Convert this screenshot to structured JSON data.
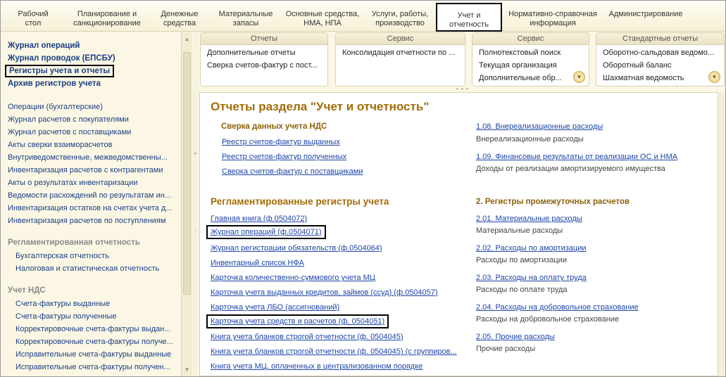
{
  "top_menu": [
    {
      "label": "Рабочий\nстол"
    },
    {
      "label": "Планирование и\nсанкционирование"
    },
    {
      "label": "Денежные\nсредства"
    },
    {
      "label": "Материальные\nзапасы"
    },
    {
      "label": "Основные средства,\nНМА, НПА"
    },
    {
      "label": "Услуги, работы,\nпроизводство"
    },
    {
      "label": "Учет и\nотчетность",
      "active": true
    },
    {
      "label": "Нормативно-справочная\nинформация"
    },
    {
      "label": "Администрирование"
    }
  ],
  "left_nav": {
    "bold_links": [
      "Журнал операций",
      "Журнал проводок (ЕПСБУ)",
      "Регистры учета и отчеты",
      "Архив регистров учета"
    ],
    "links": [
      "Операции (бухгалтерские)",
      "Журнал расчетов с покупателями",
      "Журнал расчетов с поставщиками",
      "Акты сверки взаиморасчетов",
      "Внутриведомственные, межведомственны...",
      "Инвентаризация расчетов с контрагентами",
      "Акты о результатах инвентаризации",
      "Ведомости расхождений по результатам ин...",
      "Инвентаризация остатков на счетах учета д...",
      "Инвентаризация расчетов по поступлениям"
    ],
    "group1": {
      "title": "Регламентированная отчетность",
      "items": [
        "Бухгалтерская отчетность",
        "Налоговая и статистическая отчетность"
      ]
    },
    "group2": {
      "title": "Учет НДС",
      "items": [
        "Счета-фактуры выданные",
        "Счета-фактуры полученные",
        "Корректировочные счета-фактуры выдан...",
        "Корректировочные счета-фактуры получе...",
        "Исправительные счета-фактуры выданные",
        "Исправительные счета-фактуры получен..."
      ]
    }
  },
  "command_panel": [
    {
      "header": "Отчеты",
      "items": [
        "Дополнительные отчеты",
        "Сверка счетов-фактур с пост..."
      ]
    },
    {
      "header": "Сервис",
      "items": [
        "Консолидация отчетности по ..."
      ]
    },
    {
      "header": "Сервис",
      "items": [
        "Полнотекстовый поиск",
        "Текущая организация",
        "Дополнительные обр..."
      ]
    },
    {
      "header": "Стандартные отчеты",
      "items": [
        "Оборотно-сальдовая ведомо...",
        "Оборотный баланс",
        "Шахматная ведомость"
      ]
    }
  ],
  "content": {
    "title": "Отчеты раздела \"Учет и отчетность\"",
    "vat": {
      "title": "Сверка данных учета НДС",
      "links": [
        "Реестр счетов-фактур выданных",
        "Реестр счетов-фактур полученных",
        "Сверка счетов-фактур с поставщиками"
      ]
    },
    "right_top": [
      {
        "link": "1.08. Внереализационные расходы",
        "desc": "Внереализационные расходы"
      },
      {
        "link": "1.09. Финансовые результаты от реализации ОС и НМА",
        "desc": "Доходы от реализации амортизируемого имущества"
      }
    ],
    "registers": {
      "title": "Регламентированные регистры учета",
      "links": [
        "Главная книга (ф.0504072)",
        "Журнал операций (ф.0504071)",
        "Журнал регистрации обязательств (ф.0504064)",
        "Инвентарный список НФА",
        "Карточка количественно-суммового учета МЦ",
        "Карточка учета выданных кредитов, займов (ссуд) (ф.0504057)",
        "Карточка учета ЛБО (ассигнований)",
        "Карточка учета средств и расчетов (ф. 0504051)",
        "Книга учета бланков строгой отчетности (ф. 0504045)",
        "Книга учета бланков строгой отчетности (ф. 0504045) (с группиров...",
        "Книга учета МЦ, оплаченных в централизованном порядке"
      ]
    },
    "intermediate": {
      "title": "2. Регистры промежуточных расчетов",
      "items": [
        {
          "link": "2.01. Материальные расходы",
          "desc": "Материальные расходы"
        },
        {
          "link": "2.02. Расходы по амортизации",
          "desc": "Расходы по амортизации"
        },
        {
          "link": "2.03. Расходы на оплату труда",
          "desc": "Расходы по оплате труда"
        },
        {
          "link": "2.04. Расходы на добровольное страхование",
          "desc": "Расходы на добровольное страхование"
        },
        {
          "link": "2.05. Прочие расходы",
          "desc": "Прочие расходы"
        }
      ]
    }
  }
}
